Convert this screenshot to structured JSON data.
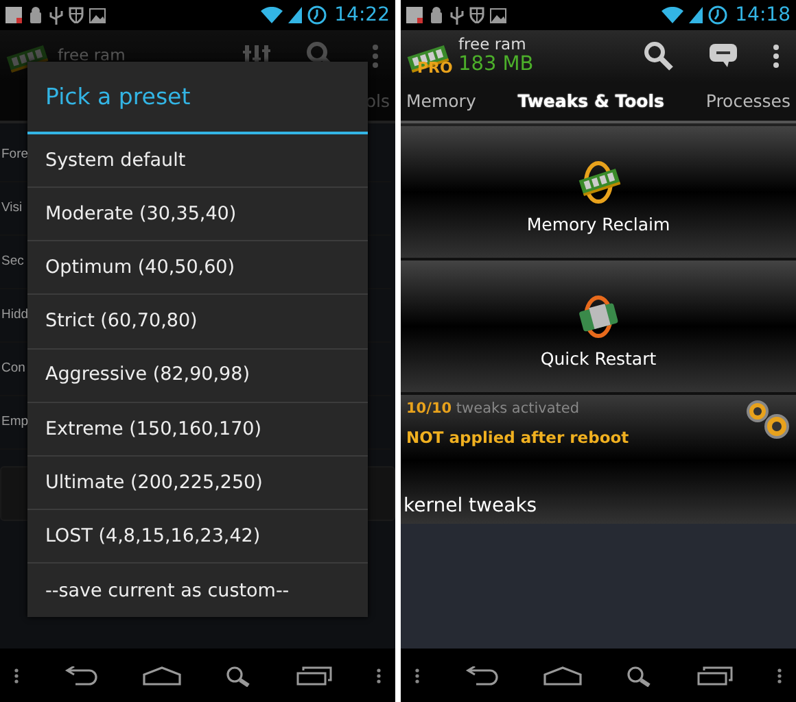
{
  "left_screen": {
    "status_bar": {
      "time": "14:22"
    },
    "app_bar": {
      "label": "free ram"
    },
    "tab_fragment": "ols",
    "background_labels": [
      "Fore",
      "Visi",
      "Sec",
      "Hidd",
      "Con",
      "Emp"
    ],
    "dialog": {
      "title": "Pick a preset",
      "options": [
        {
          "label": "System default"
        },
        {
          "label": "Moderate (30,35,40)"
        },
        {
          "label": "Optimum (40,50,60)"
        },
        {
          "label": "Strict (60,70,80)"
        },
        {
          "label": "Aggressive (82,90,98)"
        },
        {
          "label": "Extreme (150,160,170)"
        },
        {
          "label": "Ultimate (200,225,250)"
        },
        {
          "label": "LOST (4,8,15,16,23,42)"
        },
        {
          "label": "--save current as custom--"
        }
      ]
    }
  },
  "right_screen": {
    "status_bar": {
      "time": "14:18"
    },
    "app_bar": {
      "label": "free ram",
      "value": "183 MB",
      "badge": "PRO"
    },
    "tabs": [
      {
        "label": "Memory",
        "selected": false
      },
      {
        "label": "Tweaks & Tools",
        "selected": true
      },
      {
        "label": "Processes",
        "selected": false
      }
    ],
    "tools": [
      {
        "label": "Memory Reclaim",
        "kind": "reclaim"
      },
      {
        "label": "Quick Restart",
        "kind": "restart"
      }
    ],
    "tweaks": {
      "count": "10/10",
      "text": "tweaks activated",
      "warning": "NOT applied after reboot"
    },
    "section": "kernel tweaks"
  }
}
